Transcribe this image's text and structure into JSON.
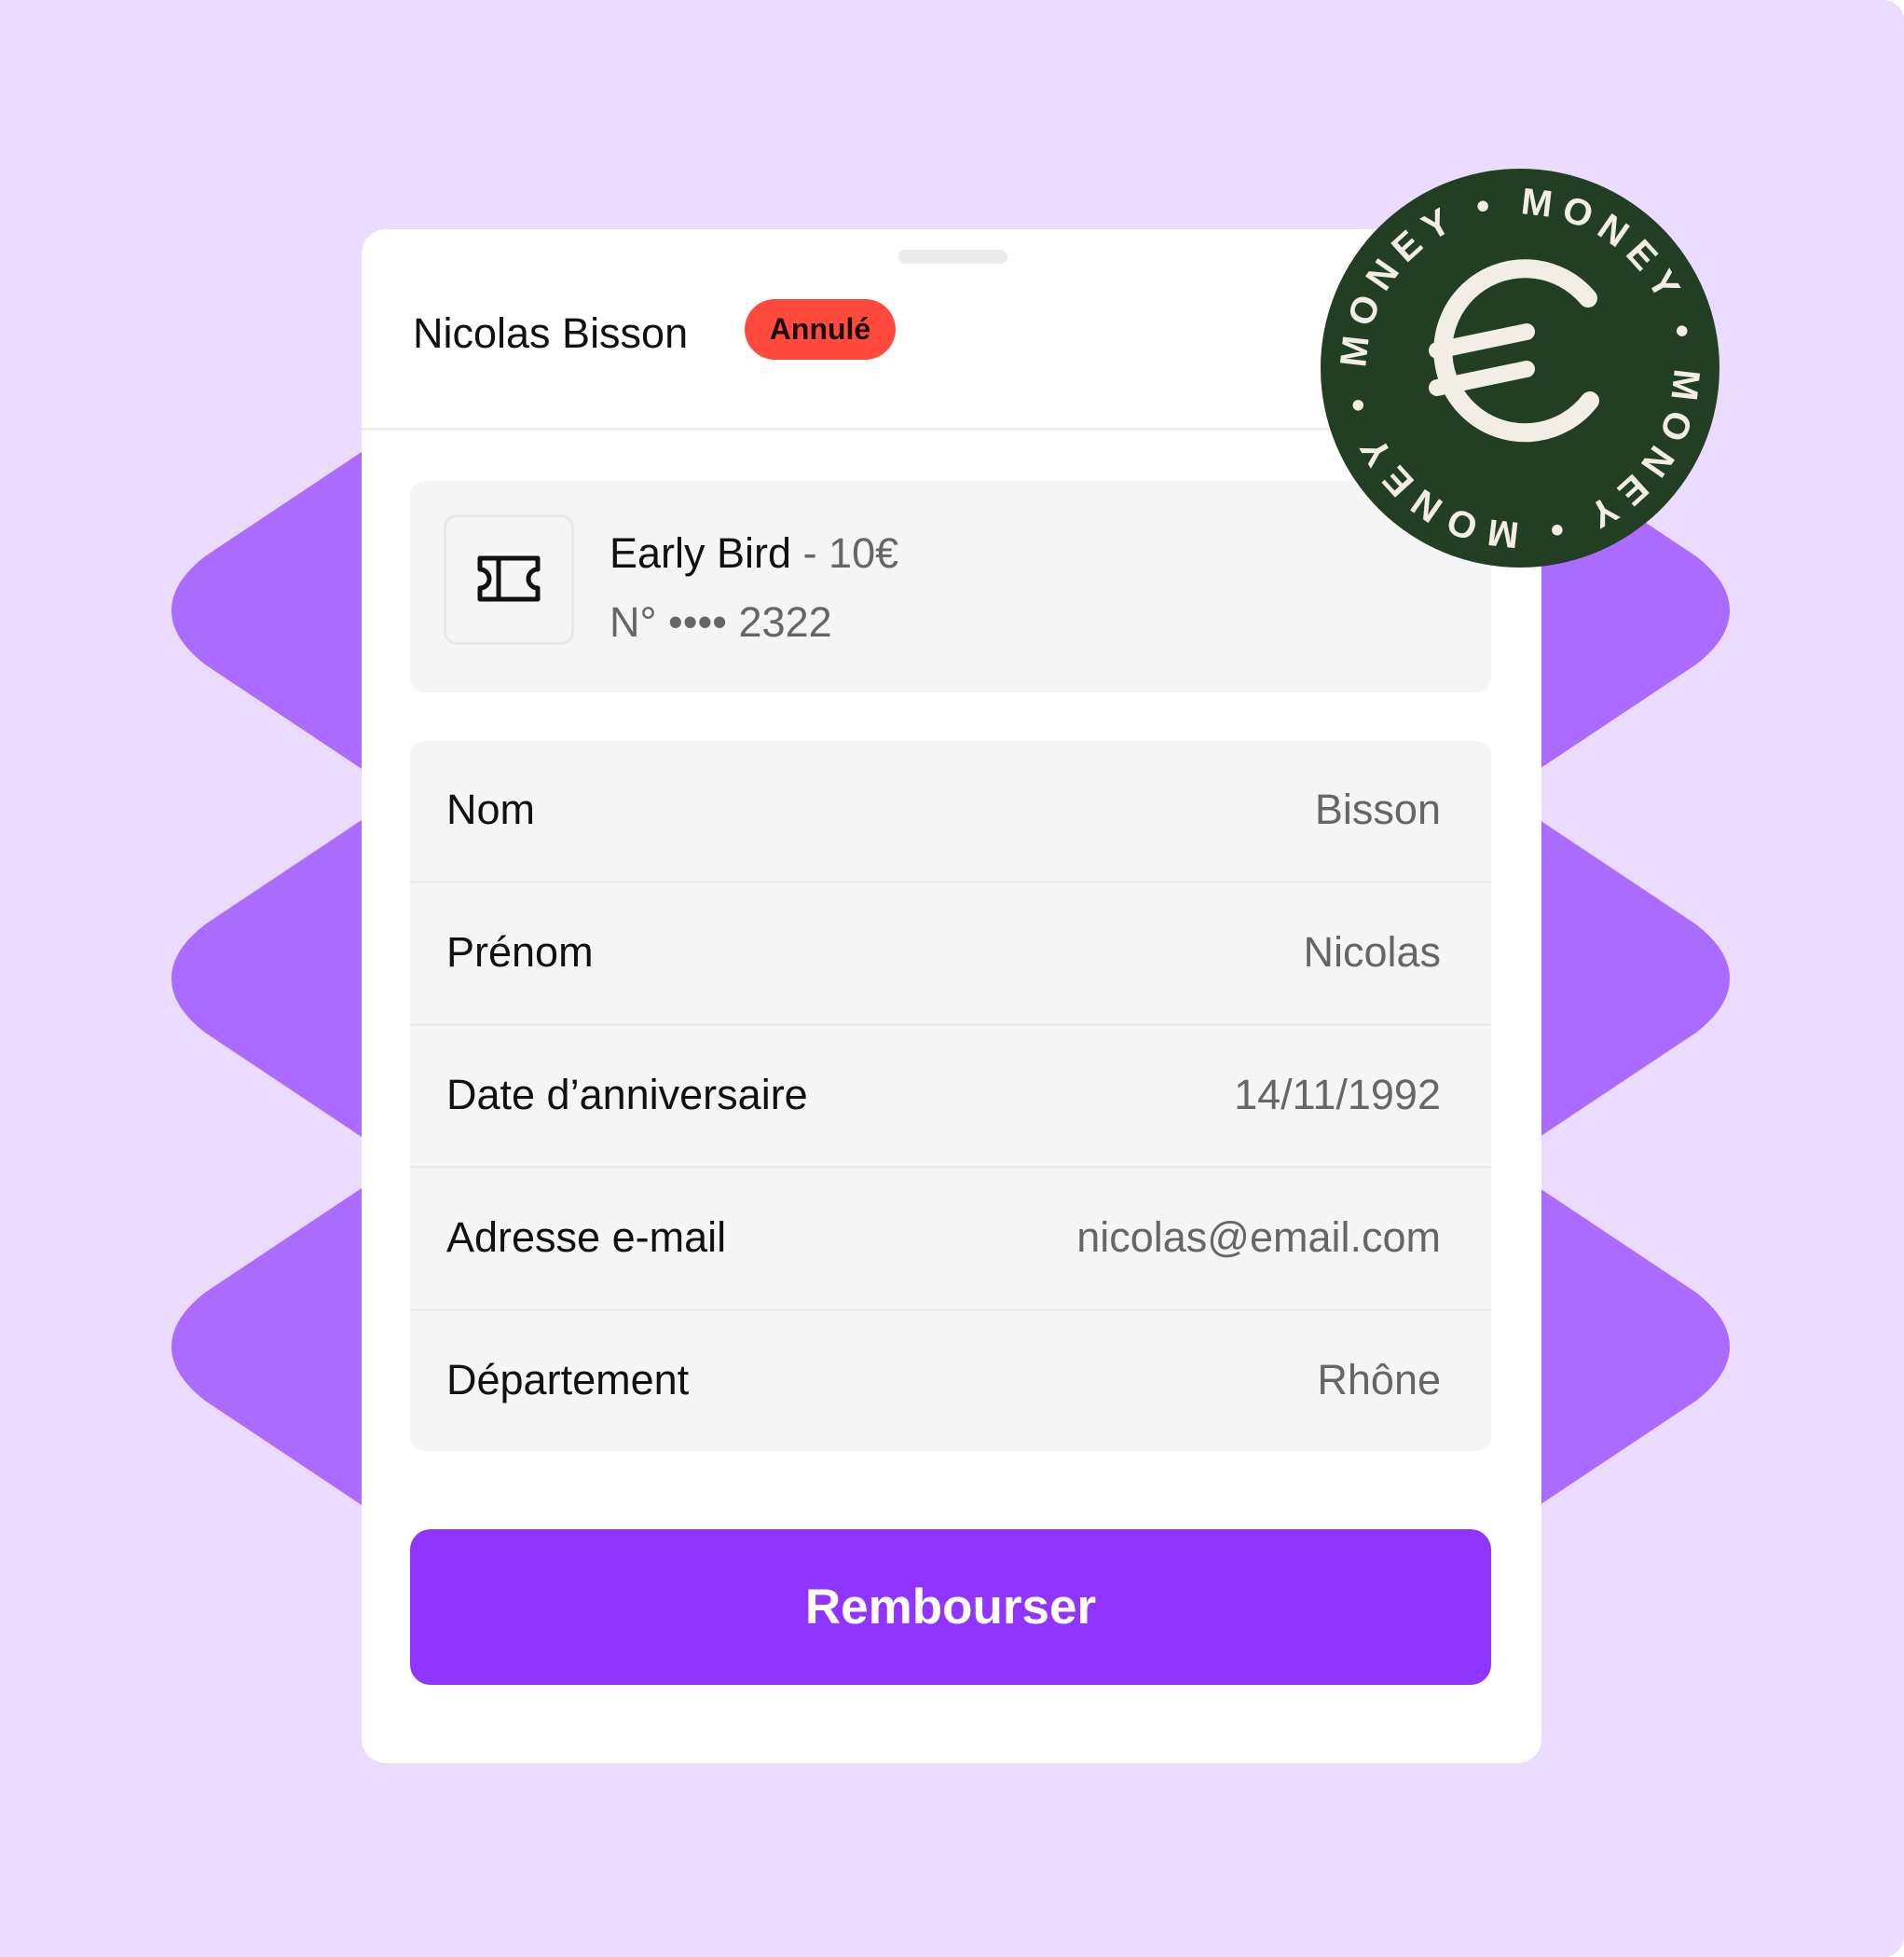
{
  "colors": {
    "background": "#eadbff",
    "shapes": "#ab6bfe",
    "card": "#ffffff",
    "panel": "#f5f5f5",
    "accent": "#8f35ff",
    "badge": "#ff4a3d",
    "stamp": "#223f24",
    "stamp_text": "#f2eee6"
  },
  "customer": {
    "name": "Nicolas Bisson",
    "status": "Annulé"
  },
  "ticket": {
    "icon": "ticket-icon",
    "name": "Early Bird",
    "price": " - 10€",
    "number": "N° •••• 2322"
  },
  "details": [
    {
      "label": "Nom",
      "value": "Bisson"
    },
    {
      "label": "Prénom",
      "value": "Nicolas"
    },
    {
      "label": "Date d’anniversaire",
      "value": "14/11/1992"
    },
    {
      "label": "Adresse e-mail",
      "value": "nicolas@email.com"
    },
    {
      "label": "Département",
      "value": "Rhône"
    }
  ],
  "actions": {
    "refund_label": "Rembourser"
  },
  "stamp": {
    "icon": "euro-icon",
    "ring_text": "MONEY • MONEY • MONEY • MONEY •"
  }
}
